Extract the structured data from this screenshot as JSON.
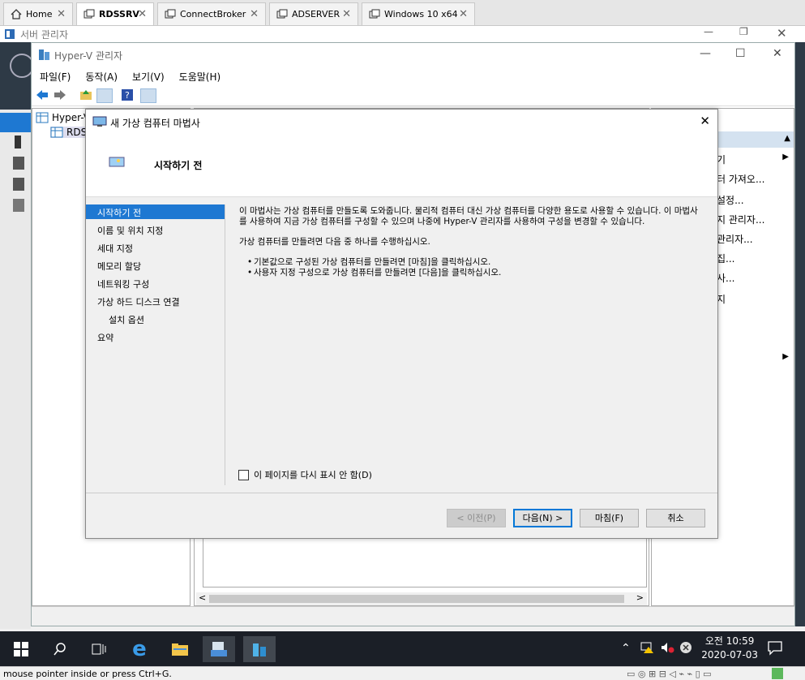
{
  "vm_tabs": [
    {
      "label": "Home",
      "icon": "home-icon"
    },
    {
      "label": "RDSSRV",
      "icon": "vm-icon"
    },
    {
      "label": "ConnectBroker",
      "icon": "vm-icon"
    },
    {
      "label": "ADSERVER",
      "icon": "vm-icon"
    },
    {
      "label": "Windows 10 x64",
      "icon": "vm-icon"
    }
  ],
  "server_manager": {
    "title": "서버 관리자"
  },
  "hyperv": {
    "title": "Hyper-V 관리자",
    "menu": [
      "파일(F)",
      "동작(A)",
      "보기(V)",
      "도움말(H)"
    ],
    "tree": {
      "root": "Hyper-V",
      "child": "RDS"
    },
    "actions": [
      "기",
      "터 가져오...",
      "설정...",
      "지 관리자...",
      "관리자...",
      "집...",
      "사...",
      "지"
    ]
  },
  "wizard": {
    "title": "새 가상 컴퓨터 마법사",
    "header": "시작하기 전",
    "steps": [
      {
        "label": "시작하기 전",
        "active": true,
        "sub": false
      },
      {
        "label": "이름 및 위치 지정",
        "active": false,
        "sub": false
      },
      {
        "label": "세대 지정",
        "active": false,
        "sub": false
      },
      {
        "label": "메모리 할당",
        "active": false,
        "sub": false
      },
      {
        "label": "네트워킹 구성",
        "active": false,
        "sub": false
      },
      {
        "label": "가상 하드 디스크 연결",
        "active": false,
        "sub": false
      },
      {
        "label": "설치 옵션",
        "active": false,
        "sub": true
      },
      {
        "label": "요약",
        "active": false,
        "sub": false
      }
    ],
    "intro": "이 마법사는 가상 컴퓨터를 만들도록 도와줍니다. 물리적 컴퓨터 대신 가상 컴퓨터를 다양한 용도로 사용할 수 있습니다. 이 마법사를 사용하여 지금 가상 컴퓨터를 구성할 수 있으며 나중에 Hyper-V 관리자를 사용하여 구성을 변경할 수 있습니다.",
    "instruction": "가상 컴퓨터를 만들려면 다음 중 하나를 수행하십시오.",
    "bullets": [
      "기본값으로 구성된 가상 컴퓨터를 만들려면 [마침]을 클릭하십시오.",
      "사용자 지정 구성으로 가상 컴퓨터를 만들려면 [다음]을 클릭하십시오."
    ],
    "checkbox_label": "이 페이지를 다시 표시 안 함(D)",
    "buttons": {
      "prev": "< 이전(P)",
      "next": "다음(N) >",
      "finish": "마침(F)",
      "cancel": "취소"
    }
  },
  "taskbar": {
    "time": "오전 10:59",
    "date": "2020-07-03"
  },
  "statusbar": {
    "text": "mouse pointer inside or press Ctrl+G."
  }
}
